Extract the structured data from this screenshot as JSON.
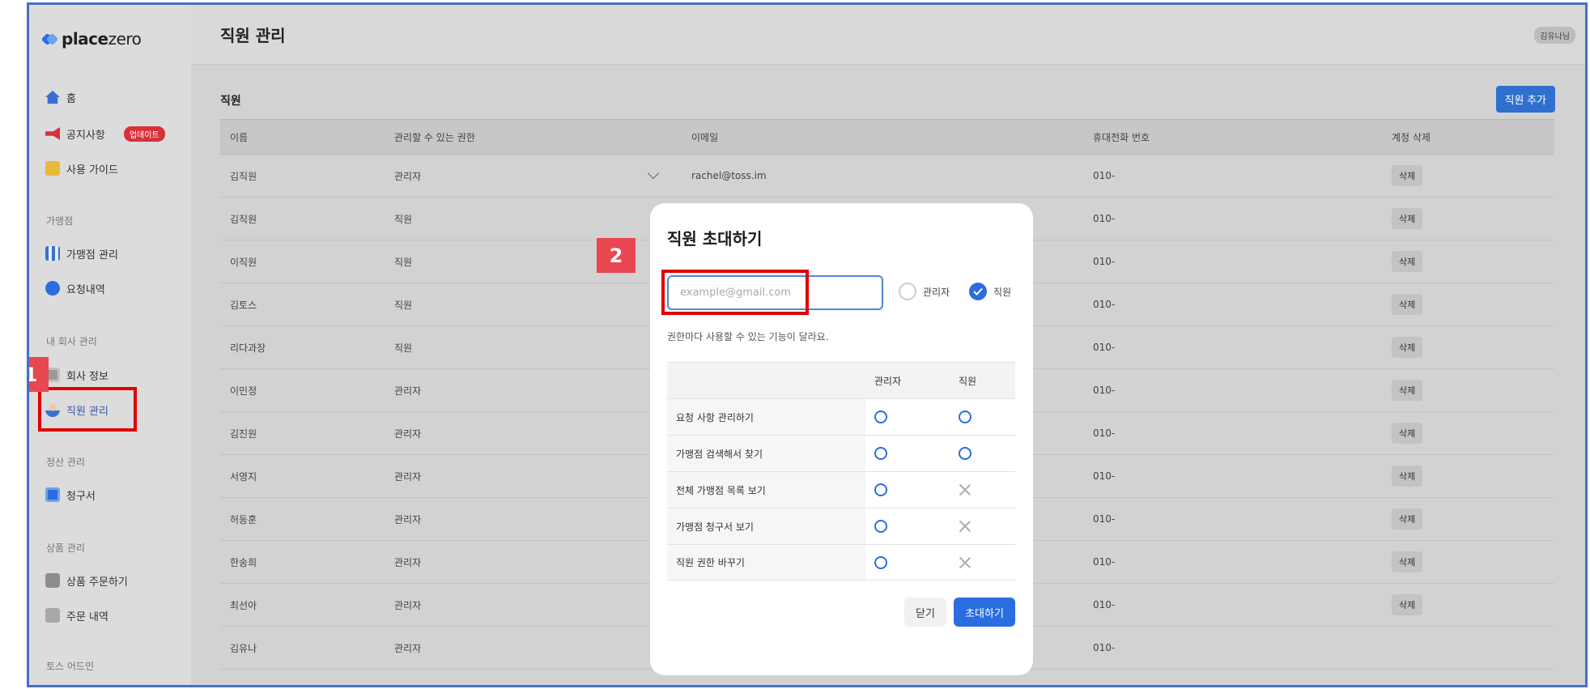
{
  "brand": {
    "name_bold": "place",
    "name_light": "zero"
  },
  "sidebar": {
    "items": [
      {
        "label": "홈",
        "icon": "home-icon"
      },
      {
        "label": "공지사항",
        "icon": "megaphone-icon",
        "badge": "업데이트"
      },
      {
        "label": "사용 가이드",
        "icon": "guide-icon"
      }
    ],
    "sections": [
      {
        "title": "가맹점",
        "items": [
          {
            "label": "가맹점 관리",
            "icon": "store-icon"
          },
          {
            "label": "요청내역",
            "icon": "chat-icon"
          }
        ]
      },
      {
        "title": "내 회사 관리",
        "items": [
          {
            "label": "회사 정보",
            "icon": "building-icon"
          },
          {
            "label": "직원 관리",
            "icon": "person-icon",
            "active": true
          }
        ]
      },
      {
        "title": "정산 관리",
        "items": [
          {
            "label": "청구서",
            "icon": "invoice-icon"
          }
        ]
      },
      {
        "title": "상품 관리",
        "items": [
          {
            "label": "상품 주문하기",
            "icon": "bag-icon"
          },
          {
            "label": "주문 내역",
            "icon": "receipt-icon"
          }
        ]
      },
      {
        "title": "토스 어드민",
        "items": []
      }
    ]
  },
  "header": {
    "title": "직원 관리",
    "user": "김유나님"
  },
  "employees": {
    "title": "직원",
    "add_label": "직원 추가",
    "columns": [
      "이름",
      "관리할 수 있는 권한",
      "이메일",
      "휴대전화 번호",
      "계정 삭제"
    ],
    "delete_label": "삭제",
    "rows": [
      {
        "name": "김직원",
        "role": "관리자",
        "email": "rachel@toss.im",
        "phone": "010-"
      },
      {
        "name": "김직원",
        "role": "직원",
        "email": "",
        "phone": "010-"
      },
      {
        "name": "이직원",
        "role": "직원",
        "email": "",
        "phone": "010-"
      },
      {
        "name": "김토스",
        "role": "직원",
        "email": "",
        "phone": "010-"
      },
      {
        "name": "리다과장",
        "role": "직원",
        "email": "",
        "phone": "010-"
      },
      {
        "name": "이민정",
        "role": "관리자",
        "email": "",
        "phone": "010-"
      },
      {
        "name": "김진원",
        "role": "관리자",
        "email": "",
        "phone": "010-"
      },
      {
        "name": "서영지",
        "role": "관리자",
        "email": "",
        "phone": "010-"
      },
      {
        "name": "허동훈",
        "role": "관리자",
        "email": "",
        "phone": "010-"
      },
      {
        "name": "한송희",
        "role": "관리자",
        "email": "",
        "phone": "010-"
      },
      {
        "name": "최선아",
        "role": "관리자",
        "email": "",
        "phone": "010-"
      },
      {
        "name": "김유나",
        "role": "관리자",
        "email": "",
        "phone": "010-"
      }
    ]
  },
  "modal": {
    "title": "직원 초대하기",
    "email_placeholder": "example@gmail.com",
    "email_value": "",
    "role_options": [
      "관리자",
      "직원"
    ],
    "selected_role": "직원",
    "description": "권한마다 사용할 수 있는 기능이 달라요.",
    "perm_headers": [
      "관리자",
      "직원"
    ],
    "permissions": [
      {
        "label": "요청 사항 관리하기",
        "admin": true,
        "staff": true
      },
      {
        "label": "가맹점 검색해서 찾기",
        "admin": true,
        "staff": true
      },
      {
        "label": "전체 가맹점 목록 보기",
        "admin": true,
        "staff": false
      },
      {
        "label": "가맹점 청구서 보기",
        "admin": true,
        "staff": false
      },
      {
        "label": "직원 권한 바꾸기",
        "admin": true,
        "staff": false
      }
    ],
    "close_label": "닫기",
    "invite_label": "초대하기"
  },
  "callouts": [
    {
      "number": "1"
    },
    {
      "number": "2"
    }
  ],
  "colors": {
    "accent": "#2a6de1",
    "highlight": "#e00000",
    "tag": "#e84752",
    "frame": "#4472c4"
  }
}
